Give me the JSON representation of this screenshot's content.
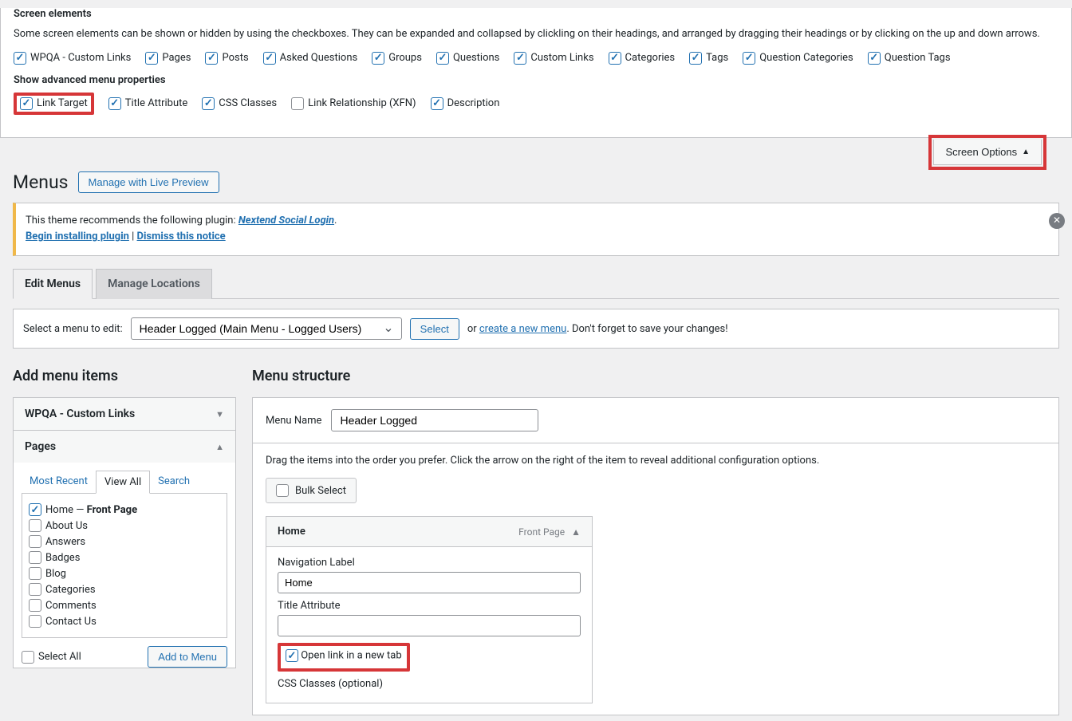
{
  "screen_options": {
    "section1_title": "Screen elements",
    "section1_desc": "Some screen elements can be shown or hidden by using the checkboxes. They can be expanded and collapsed by clickling on their headings, and arranged by dragging their headings or by clicking on the up and down arrows.",
    "boxes": [
      {
        "label": "WPQA - Custom Links",
        "checked": true
      },
      {
        "label": "Pages",
        "checked": true
      },
      {
        "label": "Posts",
        "checked": true
      },
      {
        "label": "Asked Questions",
        "checked": true
      },
      {
        "label": "Groups",
        "checked": true
      },
      {
        "label": "Questions",
        "checked": true
      },
      {
        "label": "Custom Links",
        "checked": true
      },
      {
        "label": "Categories",
        "checked": true
      },
      {
        "label": "Tags",
        "checked": true
      },
      {
        "label": "Question Categories",
        "checked": true
      },
      {
        "label": "Question Tags",
        "checked": true
      }
    ],
    "section2_title": "Show advanced menu properties",
    "adv": [
      {
        "label": "Link Target",
        "checked": true
      },
      {
        "label": "Title Attribute",
        "checked": true
      },
      {
        "label": "CSS Classes",
        "checked": true
      },
      {
        "label": "Link Relationship (XFN)",
        "checked": false
      },
      {
        "label": "Description",
        "checked": true
      }
    ],
    "button": "Screen Options"
  },
  "header": {
    "title": "Menus",
    "live_preview": "Manage with Live Preview"
  },
  "notice": {
    "text1": "This theme recommends the following plugin: ",
    "plugin": "Nextend Social Login",
    "begin": "Begin installing plugin",
    "sep": " | ",
    "dismiss": "Dismiss this notice"
  },
  "tabs": {
    "edit": "Edit Menus",
    "locations": "Manage Locations"
  },
  "select_row": {
    "label": "Select a menu to edit:",
    "value": "Header Logged (Main Menu - Logged Users)",
    "select_btn": "Select",
    "or": "or",
    "create": "create a new menu",
    "after": ". Don't forget to save your changes!"
  },
  "left": {
    "heading": "Add menu items",
    "acc1": "WPQA - Custom Links",
    "acc2": "Pages",
    "mini_tabs": {
      "recent": "Most Recent",
      "all": "View All",
      "search": "Search"
    },
    "pages": [
      {
        "label_pre": "Home — ",
        "label_bold": "Front Page",
        "checked": true
      },
      {
        "label": "About Us",
        "checked": false
      },
      {
        "label": "Answers",
        "checked": false
      },
      {
        "label": "Badges",
        "checked": false
      },
      {
        "label": "Blog",
        "checked": false
      },
      {
        "label": "Categories",
        "checked": false
      },
      {
        "label": "Comments",
        "checked": false
      },
      {
        "label": "Contact Us",
        "checked": false
      }
    ],
    "select_all": "Select All",
    "add_to_menu": "Add to Menu"
  },
  "right": {
    "heading": "Menu structure",
    "name_label": "Menu Name",
    "name_value": "Header Logged",
    "drag_help": "Drag the items into the order you prefer. Click the arrow on the right of the item to reveal additional configuration options.",
    "bulk": "Bulk Select",
    "item": {
      "title": "Home",
      "type": "Front Page",
      "nav_label": "Navigation Label",
      "nav_value": "Home",
      "title_attr": "Title Attribute",
      "open_new": "Open link in a new tab",
      "css": "CSS Classes (optional)"
    }
  }
}
